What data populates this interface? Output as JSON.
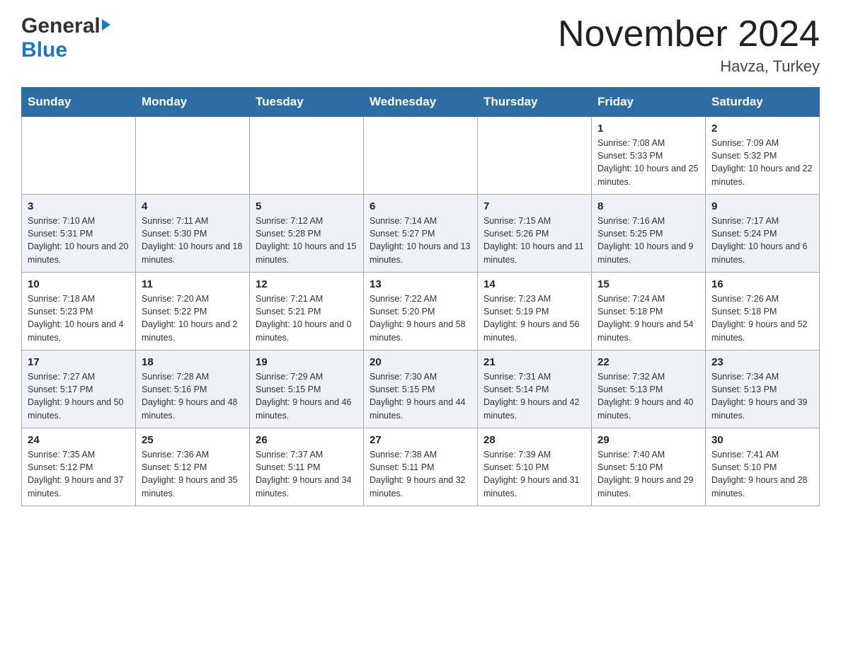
{
  "header": {
    "logo_general": "General",
    "logo_blue": "Blue",
    "month_title": "November 2024",
    "location": "Havza, Turkey"
  },
  "weekdays": [
    "Sunday",
    "Monday",
    "Tuesday",
    "Wednesday",
    "Thursday",
    "Friday",
    "Saturday"
  ],
  "weeks": [
    [
      {
        "day": "",
        "sunrise": "",
        "sunset": "",
        "daylight": ""
      },
      {
        "day": "",
        "sunrise": "",
        "sunset": "",
        "daylight": ""
      },
      {
        "day": "",
        "sunrise": "",
        "sunset": "",
        "daylight": ""
      },
      {
        "day": "",
        "sunrise": "",
        "sunset": "",
        "daylight": ""
      },
      {
        "day": "",
        "sunrise": "",
        "sunset": "",
        "daylight": ""
      },
      {
        "day": "1",
        "sunrise": "Sunrise: 7:08 AM",
        "sunset": "Sunset: 5:33 PM",
        "daylight": "Daylight: 10 hours and 25 minutes."
      },
      {
        "day": "2",
        "sunrise": "Sunrise: 7:09 AM",
        "sunset": "Sunset: 5:32 PM",
        "daylight": "Daylight: 10 hours and 22 minutes."
      }
    ],
    [
      {
        "day": "3",
        "sunrise": "Sunrise: 7:10 AM",
        "sunset": "Sunset: 5:31 PM",
        "daylight": "Daylight: 10 hours and 20 minutes."
      },
      {
        "day": "4",
        "sunrise": "Sunrise: 7:11 AM",
        "sunset": "Sunset: 5:30 PM",
        "daylight": "Daylight: 10 hours and 18 minutes."
      },
      {
        "day": "5",
        "sunrise": "Sunrise: 7:12 AM",
        "sunset": "Sunset: 5:28 PM",
        "daylight": "Daylight: 10 hours and 15 minutes."
      },
      {
        "day": "6",
        "sunrise": "Sunrise: 7:14 AM",
        "sunset": "Sunset: 5:27 PM",
        "daylight": "Daylight: 10 hours and 13 minutes."
      },
      {
        "day": "7",
        "sunrise": "Sunrise: 7:15 AM",
        "sunset": "Sunset: 5:26 PM",
        "daylight": "Daylight: 10 hours and 11 minutes."
      },
      {
        "day": "8",
        "sunrise": "Sunrise: 7:16 AM",
        "sunset": "Sunset: 5:25 PM",
        "daylight": "Daylight: 10 hours and 9 minutes."
      },
      {
        "day": "9",
        "sunrise": "Sunrise: 7:17 AM",
        "sunset": "Sunset: 5:24 PM",
        "daylight": "Daylight: 10 hours and 6 minutes."
      }
    ],
    [
      {
        "day": "10",
        "sunrise": "Sunrise: 7:18 AM",
        "sunset": "Sunset: 5:23 PM",
        "daylight": "Daylight: 10 hours and 4 minutes."
      },
      {
        "day": "11",
        "sunrise": "Sunrise: 7:20 AM",
        "sunset": "Sunset: 5:22 PM",
        "daylight": "Daylight: 10 hours and 2 minutes."
      },
      {
        "day": "12",
        "sunrise": "Sunrise: 7:21 AM",
        "sunset": "Sunset: 5:21 PM",
        "daylight": "Daylight: 10 hours and 0 minutes."
      },
      {
        "day": "13",
        "sunrise": "Sunrise: 7:22 AM",
        "sunset": "Sunset: 5:20 PM",
        "daylight": "Daylight: 9 hours and 58 minutes."
      },
      {
        "day": "14",
        "sunrise": "Sunrise: 7:23 AM",
        "sunset": "Sunset: 5:19 PM",
        "daylight": "Daylight: 9 hours and 56 minutes."
      },
      {
        "day": "15",
        "sunrise": "Sunrise: 7:24 AM",
        "sunset": "Sunset: 5:18 PM",
        "daylight": "Daylight: 9 hours and 54 minutes."
      },
      {
        "day": "16",
        "sunrise": "Sunrise: 7:26 AM",
        "sunset": "Sunset: 5:18 PM",
        "daylight": "Daylight: 9 hours and 52 minutes."
      }
    ],
    [
      {
        "day": "17",
        "sunrise": "Sunrise: 7:27 AM",
        "sunset": "Sunset: 5:17 PM",
        "daylight": "Daylight: 9 hours and 50 minutes."
      },
      {
        "day": "18",
        "sunrise": "Sunrise: 7:28 AM",
        "sunset": "Sunset: 5:16 PM",
        "daylight": "Daylight: 9 hours and 48 minutes."
      },
      {
        "day": "19",
        "sunrise": "Sunrise: 7:29 AM",
        "sunset": "Sunset: 5:15 PM",
        "daylight": "Daylight: 9 hours and 46 minutes."
      },
      {
        "day": "20",
        "sunrise": "Sunrise: 7:30 AM",
        "sunset": "Sunset: 5:15 PM",
        "daylight": "Daylight: 9 hours and 44 minutes."
      },
      {
        "day": "21",
        "sunrise": "Sunrise: 7:31 AM",
        "sunset": "Sunset: 5:14 PM",
        "daylight": "Daylight: 9 hours and 42 minutes."
      },
      {
        "day": "22",
        "sunrise": "Sunrise: 7:32 AM",
        "sunset": "Sunset: 5:13 PM",
        "daylight": "Daylight: 9 hours and 40 minutes."
      },
      {
        "day": "23",
        "sunrise": "Sunrise: 7:34 AM",
        "sunset": "Sunset: 5:13 PM",
        "daylight": "Daylight: 9 hours and 39 minutes."
      }
    ],
    [
      {
        "day": "24",
        "sunrise": "Sunrise: 7:35 AM",
        "sunset": "Sunset: 5:12 PM",
        "daylight": "Daylight: 9 hours and 37 minutes."
      },
      {
        "day": "25",
        "sunrise": "Sunrise: 7:36 AM",
        "sunset": "Sunset: 5:12 PM",
        "daylight": "Daylight: 9 hours and 35 minutes."
      },
      {
        "day": "26",
        "sunrise": "Sunrise: 7:37 AM",
        "sunset": "Sunset: 5:11 PM",
        "daylight": "Daylight: 9 hours and 34 minutes."
      },
      {
        "day": "27",
        "sunrise": "Sunrise: 7:38 AM",
        "sunset": "Sunset: 5:11 PM",
        "daylight": "Daylight: 9 hours and 32 minutes."
      },
      {
        "day": "28",
        "sunrise": "Sunrise: 7:39 AM",
        "sunset": "Sunset: 5:10 PM",
        "daylight": "Daylight: 9 hours and 31 minutes."
      },
      {
        "day": "29",
        "sunrise": "Sunrise: 7:40 AM",
        "sunset": "Sunset: 5:10 PM",
        "daylight": "Daylight: 9 hours and 29 minutes."
      },
      {
        "day": "30",
        "sunrise": "Sunrise: 7:41 AM",
        "sunset": "Sunset: 5:10 PM",
        "daylight": "Daylight: 9 hours and 28 minutes."
      }
    ]
  ]
}
